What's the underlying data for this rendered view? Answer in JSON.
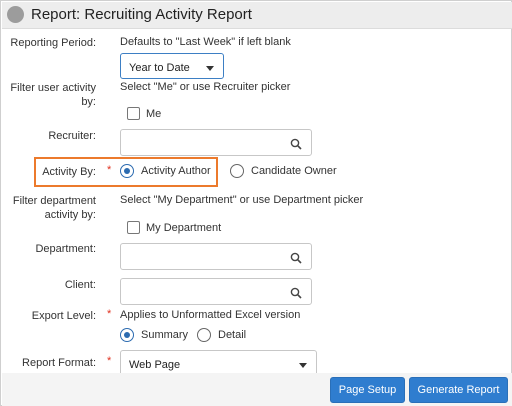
{
  "title": "Report: Recruiting Activity Report",
  "reporting_period": {
    "label": "Reporting Period:",
    "hint": "Defaults to \"Last Week\" if left blank",
    "value": "Year to Date"
  },
  "filter_user": {
    "label": "Filter user activity by:",
    "hint": "Select \"Me\" or use Recruiter picker",
    "me_label": "Me"
  },
  "recruiter": {
    "label": "Recruiter:",
    "value": ""
  },
  "activity_by": {
    "label": "Activity By:",
    "required": "*",
    "options": [
      "Activity Author",
      "Candidate Owner"
    ],
    "selected": "Activity Author"
  },
  "filter_department": {
    "label": "Filter department activity by:",
    "hint": "Select \"My Department\" or use Department picker",
    "my_department_label": "My Department"
  },
  "department": {
    "label": "Department:",
    "value": ""
  },
  "client": {
    "label": "Client:",
    "value": ""
  },
  "export_level": {
    "label": "Export Level:",
    "required": "*",
    "hint": "Applies to Unformatted Excel version",
    "options": [
      "Summary",
      "Detail"
    ],
    "selected": "Summary"
  },
  "report_format": {
    "label": "Report Format:",
    "required": "*",
    "value": "Web Page"
  },
  "buttons": {
    "page_setup": "Page Setup",
    "generate_report": "Generate Report"
  },
  "icons": {
    "title": "circle-icon",
    "lookup": "search-icon",
    "dropdown": "caret-down-icon"
  },
  "colors": {
    "accent": "#2f7dcf",
    "highlight": "#ec7a2c",
    "required": "#e0301e"
  }
}
